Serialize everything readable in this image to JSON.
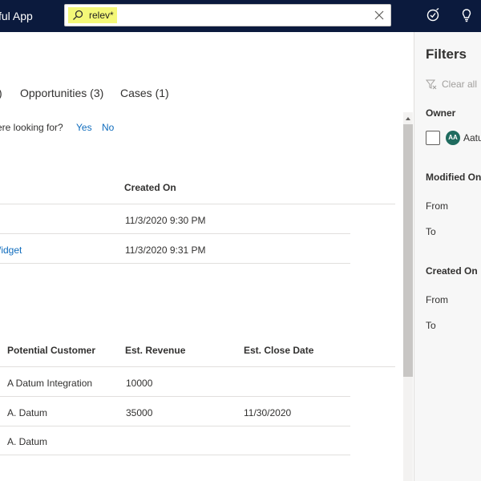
{
  "header": {
    "app_title": "ful App",
    "search_value": "relev*",
    "icons": [
      "search-icon",
      "clear-icon",
      "task-icon",
      "lightbulb-icon"
    ]
  },
  "tabs": [
    {
      "label": ")"
    },
    {
      "label": "Opportunities (3)"
    },
    {
      "label": "Cases (1)"
    }
  ],
  "feedback": {
    "question": "ere looking for?",
    "yes": "Yes",
    "no": "No"
  },
  "table1": {
    "columns": [
      "Created On"
    ],
    "rows": [
      {
        "name": "",
        "created_on": "11/3/2020 9:30 PM"
      },
      {
        "name": "/idget",
        "created_on": "11/3/2020 9:31 PM"
      }
    ]
  },
  "table2": {
    "columns": [
      "Potential Customer",
      "Est. Revenue",
      "Est. Close Date"
    ],
    "rows": [
      {
        "customer": "A Datum Integration",
        "revenue": "10000",
        "close_date": ""
      },
      {
        "customer": "A. Datum",
        "revenue": "35000",
        "close_date": "11/30/2020"
      },
      {
        "customer": "A. Datum",
        "revenue": "",
        "close_date": ""
      }
    ]
  },
  "filters": {
    "title": "Filters",
    "clear_all": "Clear all",
    "owner": {
      "label": "Owner",
      "avatar": "AA",
      "name": "Aatu"
    },
    "modified_on": {
      "label": "Modified On",
      "from": "From",
      "to": "To"
    },
    "created_on": {
      "label": "Created On",
      "from": "From",
      "to": "To"
    }
  },
  "colors": {
    "topbar": "#0b1a3d",
    "search_highlight": "#f4f878",
    "link": "#0f6cbd",
    "avatar": "#1f6b5f"
  }
}
